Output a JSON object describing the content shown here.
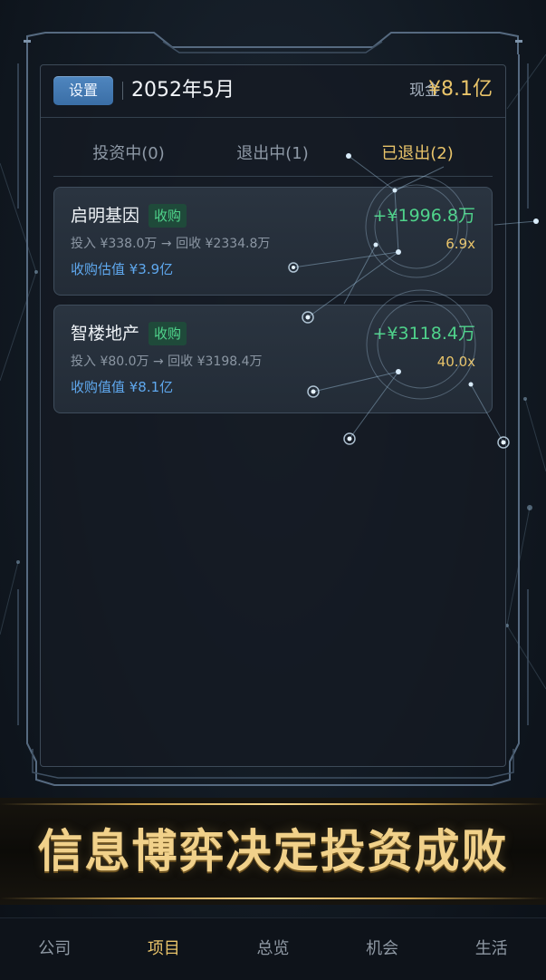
{
  "header": {
    "settings_label": "设置",
    "date": "2052年5月",
    "cash_label": "现金",
    "cash_value": "¥8.1亿"
  },
  "tabs": [
    {
      "label": "投资中(0)",
      "active": false
    },
    {
      "label": "退出中(1)",
      "active": false
    },
    {
      "label": "已退出(2)",
      "active": true
    }
  ],
  "cards": [
    {
      "name": "启明基因",
      "tag": "收购",
      "flow": "投入 ¥338.0万 → 回收 ¥2334.8万",
      "valuation": "收购估值 ¥3.9亿",
      "profit": "+¥1996.8万",
      "multiple": "6.9x"
    },
    {
      "name": "智楼地产",
      "tag": "收购",
      "flow": "投入 ¥80.0万 → 回收 ¥3198.4万",
      "valuation": "收购值值 ¥8.1亿",
      "profit": "+¥3118.4万",
      "multiple": "40.0x"
    }
  ],
  "banner": {
    "text": "信息博弈决定投资成败"
  },
  "nav": [
    {
      "label": "公司",
      "active": false
    },
    {
      "label": "项目",
      "active": true
    },
    {
      "label": "总览",
      "active": false
    },
    {
      "label": "机会",
      "active": false
    },
    {
      "label": "生活",
      "active": false
    }
  ],
  "colors": {
    "accent_gold": "#e9c46a",
    "profit_green": "#4fd38b",
    "link_blue": "#5fa8ee",
    "button_blue": "#4a80ba"
  }
}
